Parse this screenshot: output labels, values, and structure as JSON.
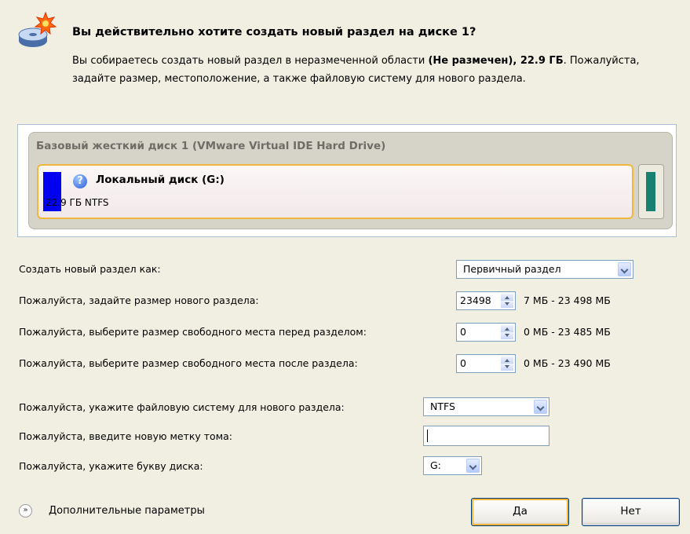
{
  "header": {
    "title": "Вы действительно хотите создать новый раздел на диске 1?",
    "desc_part1": "Вы собираетесь создать новый раздел в неразмеченной области ",
    "desc_bold": "(Не размечен), 22.9 ГБ",
    "desc_part2": ". Пожалуйста, задайте размер, местоположение, а также файловую систему для нового раздела."
  },
  "disk_map": {
    "title": "Базовый жесткий диск 1 (VMware Virtual IDE Hard Drive)",
    "partition_name": "Локальный диск (G:)",
    "partition_info": "22.9 ГБ NTFS",
    "partition_color": "#0000f0",
    "free_color": "#178070",
    "help_icon_glyph": "?"
  },
  "form": {
    "create_as": {
      "label": "Создать новый раздел как:",
      "value": "Первичный раздел"
    },
    "size": {
      "label": "Пожалуйста, задайте размер нового раздела:",
      "value": "23498",
      "range": "7 МБ - 23 498 МБ"
    },
    "space_before": {
      "label": "Пожалуйста, выберите размер свободного места перед разделом:",
      "value": "0",
      "range": "0 МБ - 23 485 МБ"
    },
    "space_after": {
      "label": "Пожалуйста, выберите размер свободного места после раздела:",
      "value": "0",
      "range": "0 МБ - 23 490 МБ"
    },
    "filesystem": {
      "label": "Пожалуйста, укажите файловую систему для нового раздела:",
      "value": "NTFS"
    },
    "volume_label": {
      "label": "Пожалуйста, введите новую метку тома:",
      "value": ""
    },
    "drive_letter": {
      "label": "Пожалуйста, укажите букву диска:",
      "value": "G:"
    }
  },
  "footer": {
    "advanced_label": "Дополнительные параметры",
    "advanced_icon_glyph": "»",
    "yes_label": "Да",
    "no_label": "Нет"
  }
}
